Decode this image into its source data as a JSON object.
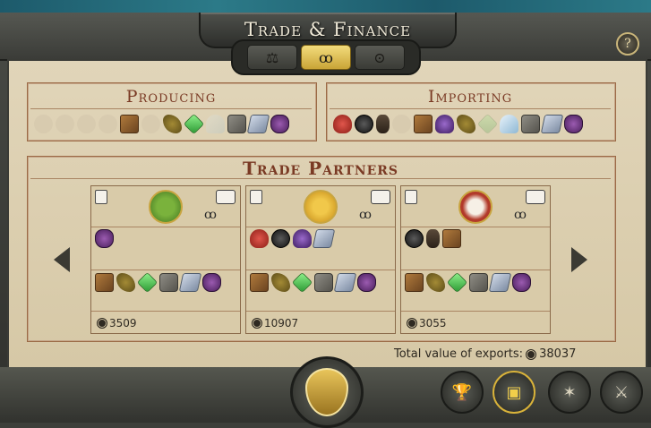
{
  "window": {
    "title": "Trade & Finance",
    "help_label": "?"
  },
  "tabs": [
    {
      "name": "trade-agreements",
      "glyph": "⚖",
      "active": false
    },
    {
      "name": "trade",
      "glyph": "ꝏ",
      "active": true
    },
    {
      "name": "finance",
      "glyph": "⊙",
      "active": false
    }
  ],
  "producing": {
    "title": "Producing",
    "goods": [
      {
        "icon": "grain-icon",
        "available": false
      },
      {
        "icon": "stone-disc-icon",
        "available": false
      },
      {
        "icon": "idol-icon",
        "available": false
      },
      {
        "icon": "leaf-icon",
        "available": false
      },
      {
        "icon": "timber-icon",
        "available": true
      },
      {
        "icon": "pottery-icon",
        "available": false
      },
      {
        "icon": "hemp-icon",
        "available": true
      },
      {
        "icon": "gem-icon",
        "available": true
      },
      {
        "icon": "salt-icon",
        "available": false
      },
      {
        "icon": "stone-icon",
        "available": true
      },
      {
        "icon": "iron-icon",
        "available": true
      },
      {
        "icon": "wine-icon",
        "available": true
      }
    ]
  },
  "importing": {
    "title": "Importing",
    "goods": [
      {
        "icon": "meat-icon",
        "available": true
      },
      {
        "icon": "coal-icon",
        "available": true
      },
      {
        "icon": "tool-icon",
        "available": true
      },
      {
        "icon": "leaf-icon",
        "available": false
      },
      {
        "icon": "timber-icon",
        "available": true
      },
      {
        "icon": "purple-dye-icon",
        "available": true
      },
      {
        "icon": "hemp-icon",
        "available": true
      },
      {
        "icon": "gem-icon",
        "available": false
      },
      {
        "icon": "salt-icon",
        "available": true
      },
      {
        "icon": "stone-icon",
        "available": true
      },
      {
        "icon": "iron-icon",
        "available": true
      },
      {
        "icon": "wine-icon",
        "available": true
      }
    ]
  },
  "partners": {
    "title": "Trade Partners",
    "cards": [
      {
        "emblem": "green",
        "imports": [
          "wine-icon"
        ],
        "exports": [
          "timber-icon",
          "hemp-icon",
          "gem-icon",
          "stone-icon",
          "iron-icon",
          "wine-icon"
        ],
        "value": "3509"
      },
      {
        "emblem": "yellow",
        "imports": [
          "meat-icon",
          "coal-icon",
          "purple-dye-icon",
          "iron-icon"
        ],
        "exports": [
          "timber-icon",
          "hemp-icon",
          "gem-icon",
          "stone-icon",
          "iron-icon",
          "wine-icon"
        ],
        "value": "10907"
      },
      {
        "emblem": "red",
        "imports": [
          "coal-icon",
          "tool-icon",
          "timber-icon"
        ],
        "exports": [
          "timber-icon",
          "hemp-icon",
          "gem-icon",
          "stone-icon",
          "iron-icon",
          "wine-icon"
        ],
        "value": "3055"
      }
    ]
  },
  "total": {
    "label": "Total value of exports:",
    "value": "38037"
  },
  "bottom_buttons": [
    {
      "name": "diplomacy-button",
      "glyph": "🏆",
      "active": false
    },
    {
      "name": "trade-button",
      "glyph": "▣",
      "active": true
    },
    {
      "name": "technology-button",
      "glyph": "✶",
      "active": false
    },
    {
      "name": "war-button",
      "glyph": "⚔",
      "active": false
    }
  ],
  "colors": {
    "parchment": "#ddd0b0",
    "section_title": "#7a3a24",
    "active_tab": "#e3c257"
  }
}
